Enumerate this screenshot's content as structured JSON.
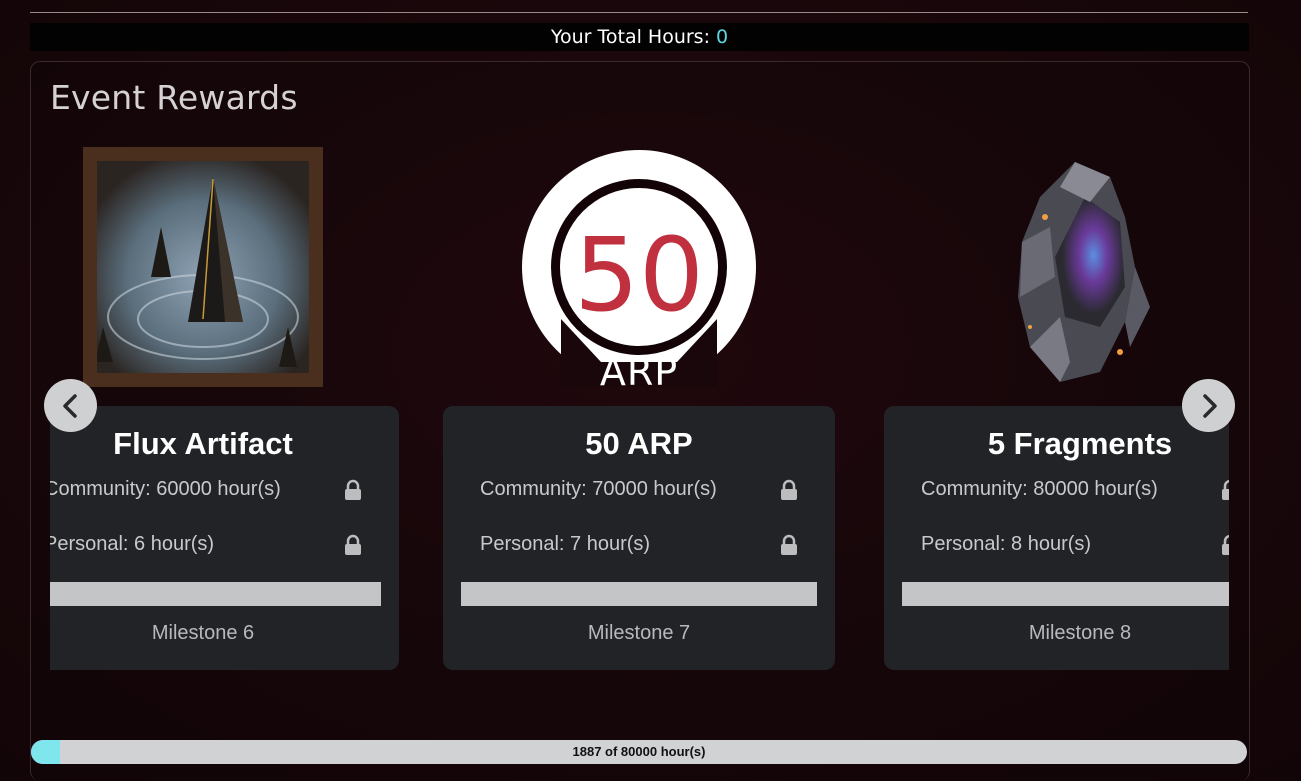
{
  "total": {
    "label": "Your Total Hours:",
    "value": "0"
  },
  "panel": {
    "title": "Event Rewards"
  },
  "rewards": [
    {
      "name": "Flux Artifact",
      "community": "Community: 60000 hour(s)",
      "personal": "Personal: 6 hour(s)",
      "milestone": "Milestone 6",
      "image": "flux-artifact-image"
    },
    {
      "name": "50 ARP",
      "community": "Community: 70000 hour(s)",
      "personal": "Personal: 7 hour(s)",
      "milestone": "Milestone 7",
      "image": "arp-coin-image",
      "coin_value": "50",
      "coin_brand": "ARP"
    },
    {
      "name": "5 Fragments",
      "community": "Community: 80000 hour(s)",
      "personal": "Personal: 8 hour(s)",
      "milestone": "Milestone 8",
      "image": "fragments-crystal-image"
    }
  ],
  "community_progress": {
    "label": "1887 of 80000 hour(s)",
    "current": 1887,
    "goal": 80000
  },
  "colors": {
    "accent": "#5ed6e3",
    "progress_fill": "#7fe6ee",
    "card_bg": "#212327",
    "arp_red": "#c0303e"
  }
}
